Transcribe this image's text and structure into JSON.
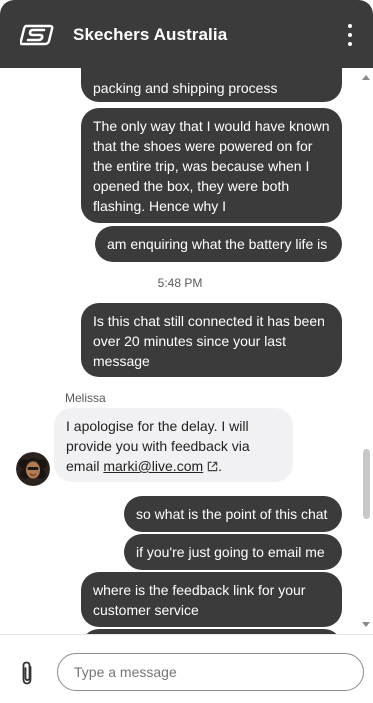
{
  "header": {
    "title": "Skechers Australia",
    "brand_color": "#3b3b3b"
  },
  "messages": {
    "out_partial": "packing and shipping process",
    "out_1": "The only way that I would have known that the shoes were powered on for the entire trip, was because when I opened the box, they were both flashing. Hence why I",
    "out_2": "am enquiring what the battery life is",
    "timestamp": "5:48 PM",
    "out_3": "Is this chat still connected it has been over 20 minutes since your last message",
    "agent_name": "Melissa",
    "in_1_text": "I apologise for the delay. I will provide you with feedback via email ",
    "in_1_link": "marki@live.com",
    "in_1_end": ".",
    "out_4": "so what is the point of this chat",
    "out_5": "if you're just going to email me",
    "out_6": "where is the feedback link for your customer service"
  },
  "composer": {
    "placeholder": "Type a message"
  },
  "icons": {
    "logo": "skechers-logo-icon",
    "menu": "more-vertical-icon",
    "attach": "paperclip-icon",
    "external_link": "external-link-icon"
  }
}
